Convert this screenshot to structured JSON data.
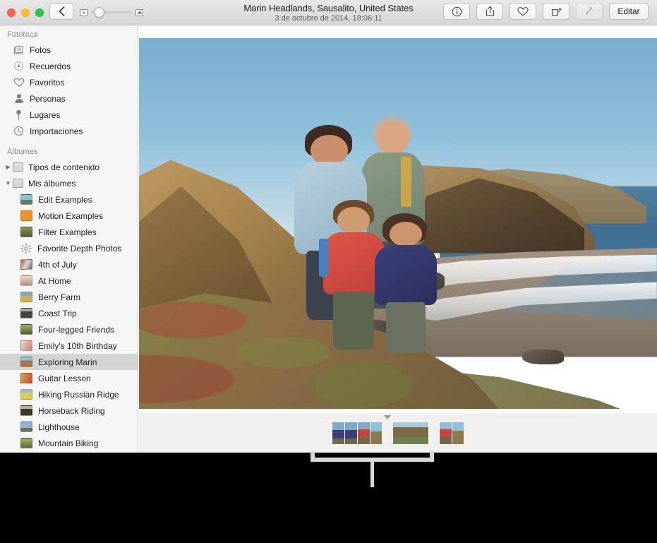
{
  "window": {
    "title": "Marin Headlands, Sausalito, United States",
    "subtitle": "3 de octubre de 2014, 18:06:11"
  },
  "toolbar": {
    "back_label": "‹",
    "zoom_small_icon": "thumbnail-small-icon",
    "zoom_large_icon": "thumbnail-large-icon",
    "zoom_value": "22",
    "buttons": [
      {
        "name": "info-button",
        "icon": "info-icon",
        "label": ""
      },
      {
        "name": "share-button",
        "icon": "share-icon",
        "label": ""
      },
      {
        "name": "favorite-button",
        "icon": "heart-icon",
        "label": ""
      },
      {
        "name": "rotate-button",
        "icon": "rotate-icon",
        "label": ""
      },
      {
        "name": "enhance-button",
        "icon": "magic-wand-icon",
        "label": ""
      }
    ],
    "edit_label": "Editar"
  },
  "sidebar": {
    "library_header": "Fototeca",
    "library_items": [
      {
        "label": "Fotos",
        "icon": "photos-icon"
      },
      {
        "label": "Recuerdos",
        "icon": "memories-icon"
      },
      {
        "label": "Favoritos",
        "icon": "heart-icon"
      },
      {
        "label": "Personas",
        "icon": "person-icon"
      },
      {
        "label": "Lugares",
        "icon": "pin-icon"
      },
      {
        "label": "Importaciones",
        "icon": "clock-icon"
      }
    ],
    "albums_header": "Álbumes",
    "folders": [
      {
        "label": "Tipos de contenido",
        "expanded": false,
        "triangle": "▶"
      },
      {
        "label": "Mis álbumes",
        "expanded": true,
        "triangle": "▼"
      }
    ],
    "albums": [
      {
        "label": "Edit Examples",
        "thumb": "#5a83a8",
        "selected": false
      },
      {
        "label": "Motion Examples",
        "thumb": "#f0922b",
        "selected": false
      },
      {
        "label": "Filter Examples",
        "thumb": "#5e7a3c",
        "selected": false
      },
      {
        "label": "Favorite Depth Photos",
        "thumb": "gear",
        "selected": false
      },
      {
        "label": "4th of July",
        "thumb": "#c25a5a",
        "selected": false
      },
      {
        "label": "At Home",
        "thumb": "#d9cfc2",
        "selected": false
      },
      {
        "label": "Berry Farm",
        "thumb": "#c9a23c",
        "selected": false
      },
      {
        "label": "Coast Trip",
        "thumb": "#3f4a35",
        "selected": false
      },
      {
        "label": "Four-legged Friends",
        "thumb": "#6f8a55",
        "selected": false
      },
      {
        "label": "Emily's 10th Birthday",
        "thumb": "#c97f6a",
        "selected": false
      },
      {
        "label": "Exploring Marin",
        "thumb": "#8a6a48",
        "selected": true
      },
      {
        "label": "Guitar Lesson",
        "thumb": "#d06a3a",
        "selected": false
      },
      {
        "label": "Hiking Russian Ridge",
        "thumb": "#d6c44a",
        "selected": false
      },
      {
        "label": "Horseback Riding",
        "thumb": "#4a4038",
        "selected": false
      },
      {
        "label": "Lighthouse",
        "thumb": "#7fa8c6",
        "selected": false
      },
      {
        "label": "Mountain Biking",
        "thumb": "#6b7a44",
        "selected": false
      }
    ]
  },
  "photo": {
    "alt": "Family of four standing on a coastal cliff above a beach at Marin Headlands",
    "sky_color": "#8fc0da",
    "ocean_color": "#43708f",
    "cliff_color": "#a8864f",
    "sand_color": "#8d7f70"
  },
  "filmstrip": {
    "marker": "current-photo-marker",
    "groups": [
      {
        "thumbs": [
          "#6c86a0",
          "#6c86a0",
          "#8d5f54",
          "#7d7560"
        ]
      },
      {
        "thumbs": [
          "#7a6a4c"
        ]
      },
      {
        "thumbs": [
          "#8a5a50",
          "#7f7860"
        ]
      }
    ]
  },
  "callout": {
    "name": "filmstrip-callout-bracket",
    "color": "#d8d8d8"
  }
}
